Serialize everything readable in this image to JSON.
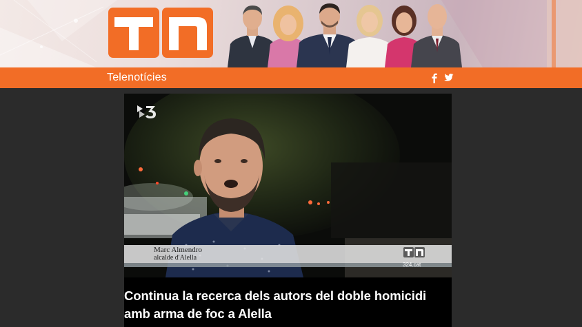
{
  "header": {
    "logo_text": "TN",
    "brand_label": "Telenotícies",
    "social": [
      "facebook-icon",
      "twitter-icon"
    ]
  },
  "video": {
    "channel_logo": "3",
    "caption": {
      "name": "Marc Almendro",
      "role": "alcalde d'Alella",
      "logo_text": "TN",
      "site": "324.cat"
    }
  },
  "article": {
    "headline": "Continua la recerca dels autors del doble homicidi amb arma de foc a Alella"
  },
  "colors": {
    "accent": "#f26d26",
    "background": "#2b2b2b",
    "headline": "#ffffff"
  }
}
